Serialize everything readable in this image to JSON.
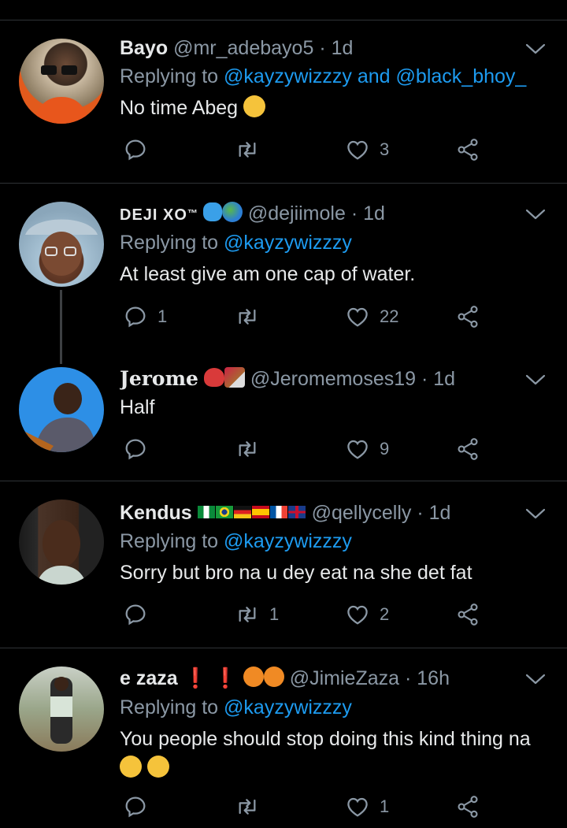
{
  "tweets": [
    {
      "name": "Bayo",
      "handle": "@mr_adebayo5",
      "dot": "·",
      "time": "1d",
      "replying_prefix": "Replying to",
      "mention1": "@kayzywizzzy",
      "and": "and",
      "mention2": "@black_bhoy_",
      "text": "No time Abeg",
      "reply_count": "",
      "retweet_count": "",
      "like_count": "3"
    },
    {
      "name": "DEJI XO",
      "name_suffix": "™",
      "handle": "@dejiimole",
      "dot": "·",
      "time": "1d",
      "replying_prefix": "Replying to",
      "mention1": "@kayzywizzzy",
      "text": "At least give am one cap of water.",
      "reply_count": "1",
      "retweet_count": "",
      "like_count": "22"
    },
    {
      "name": "Jerome",
      "handle": "@Jeromemoses19",
      "dot": "·",
      "time": "1d",
      "text": "Half",
      "reply_count": "",
      "retweet_count": "",
      "like_count": "9"
    },
    {
      "name": "Kendus",
      "handle": "@qellycelly",
      "dot": "·",
      "time": "1d",
      "replying_prefix": "Replying to",
      "mention1": "@kayzywizzzy",
      "text": "Sorry but bro na u dey eat na she det fat",
      "reply_count": "",
      "retweet_count": "1",
      "like_count": "2"
    },
    {
      "name": "e zaza",
      "name_suffix": "❗ ❗",
      "handle": "@JimieZaza",
      "dot": "·",
      "time": "16h",
      "replying_prefix": "Replying to",
      "mention1": "@kayzywizzzy",
      "text": "You people should stop doing this kind thing na",
      "reply_count": "",
      "retweet_count": "",
      "like_count": "1"
    }
  ],
  "colors": {
    "background": "#000000",
    "accent": "#1d9bf0",
    "muted": "#8b98a5",
    "divider": "#2f3336"
  },
  "icons": [
    "chevron-down-icon",
    "reply-icon",
    "retweet-icon",
    "like-icon",
    "share-icon",
    "tears-of-joy-emoji",
    "sweat-drops-emoji",
    "globe-emoji",
    "heart-emoji",
    "guitar-emoji",
    "basketball-emoji"
  ]
}
